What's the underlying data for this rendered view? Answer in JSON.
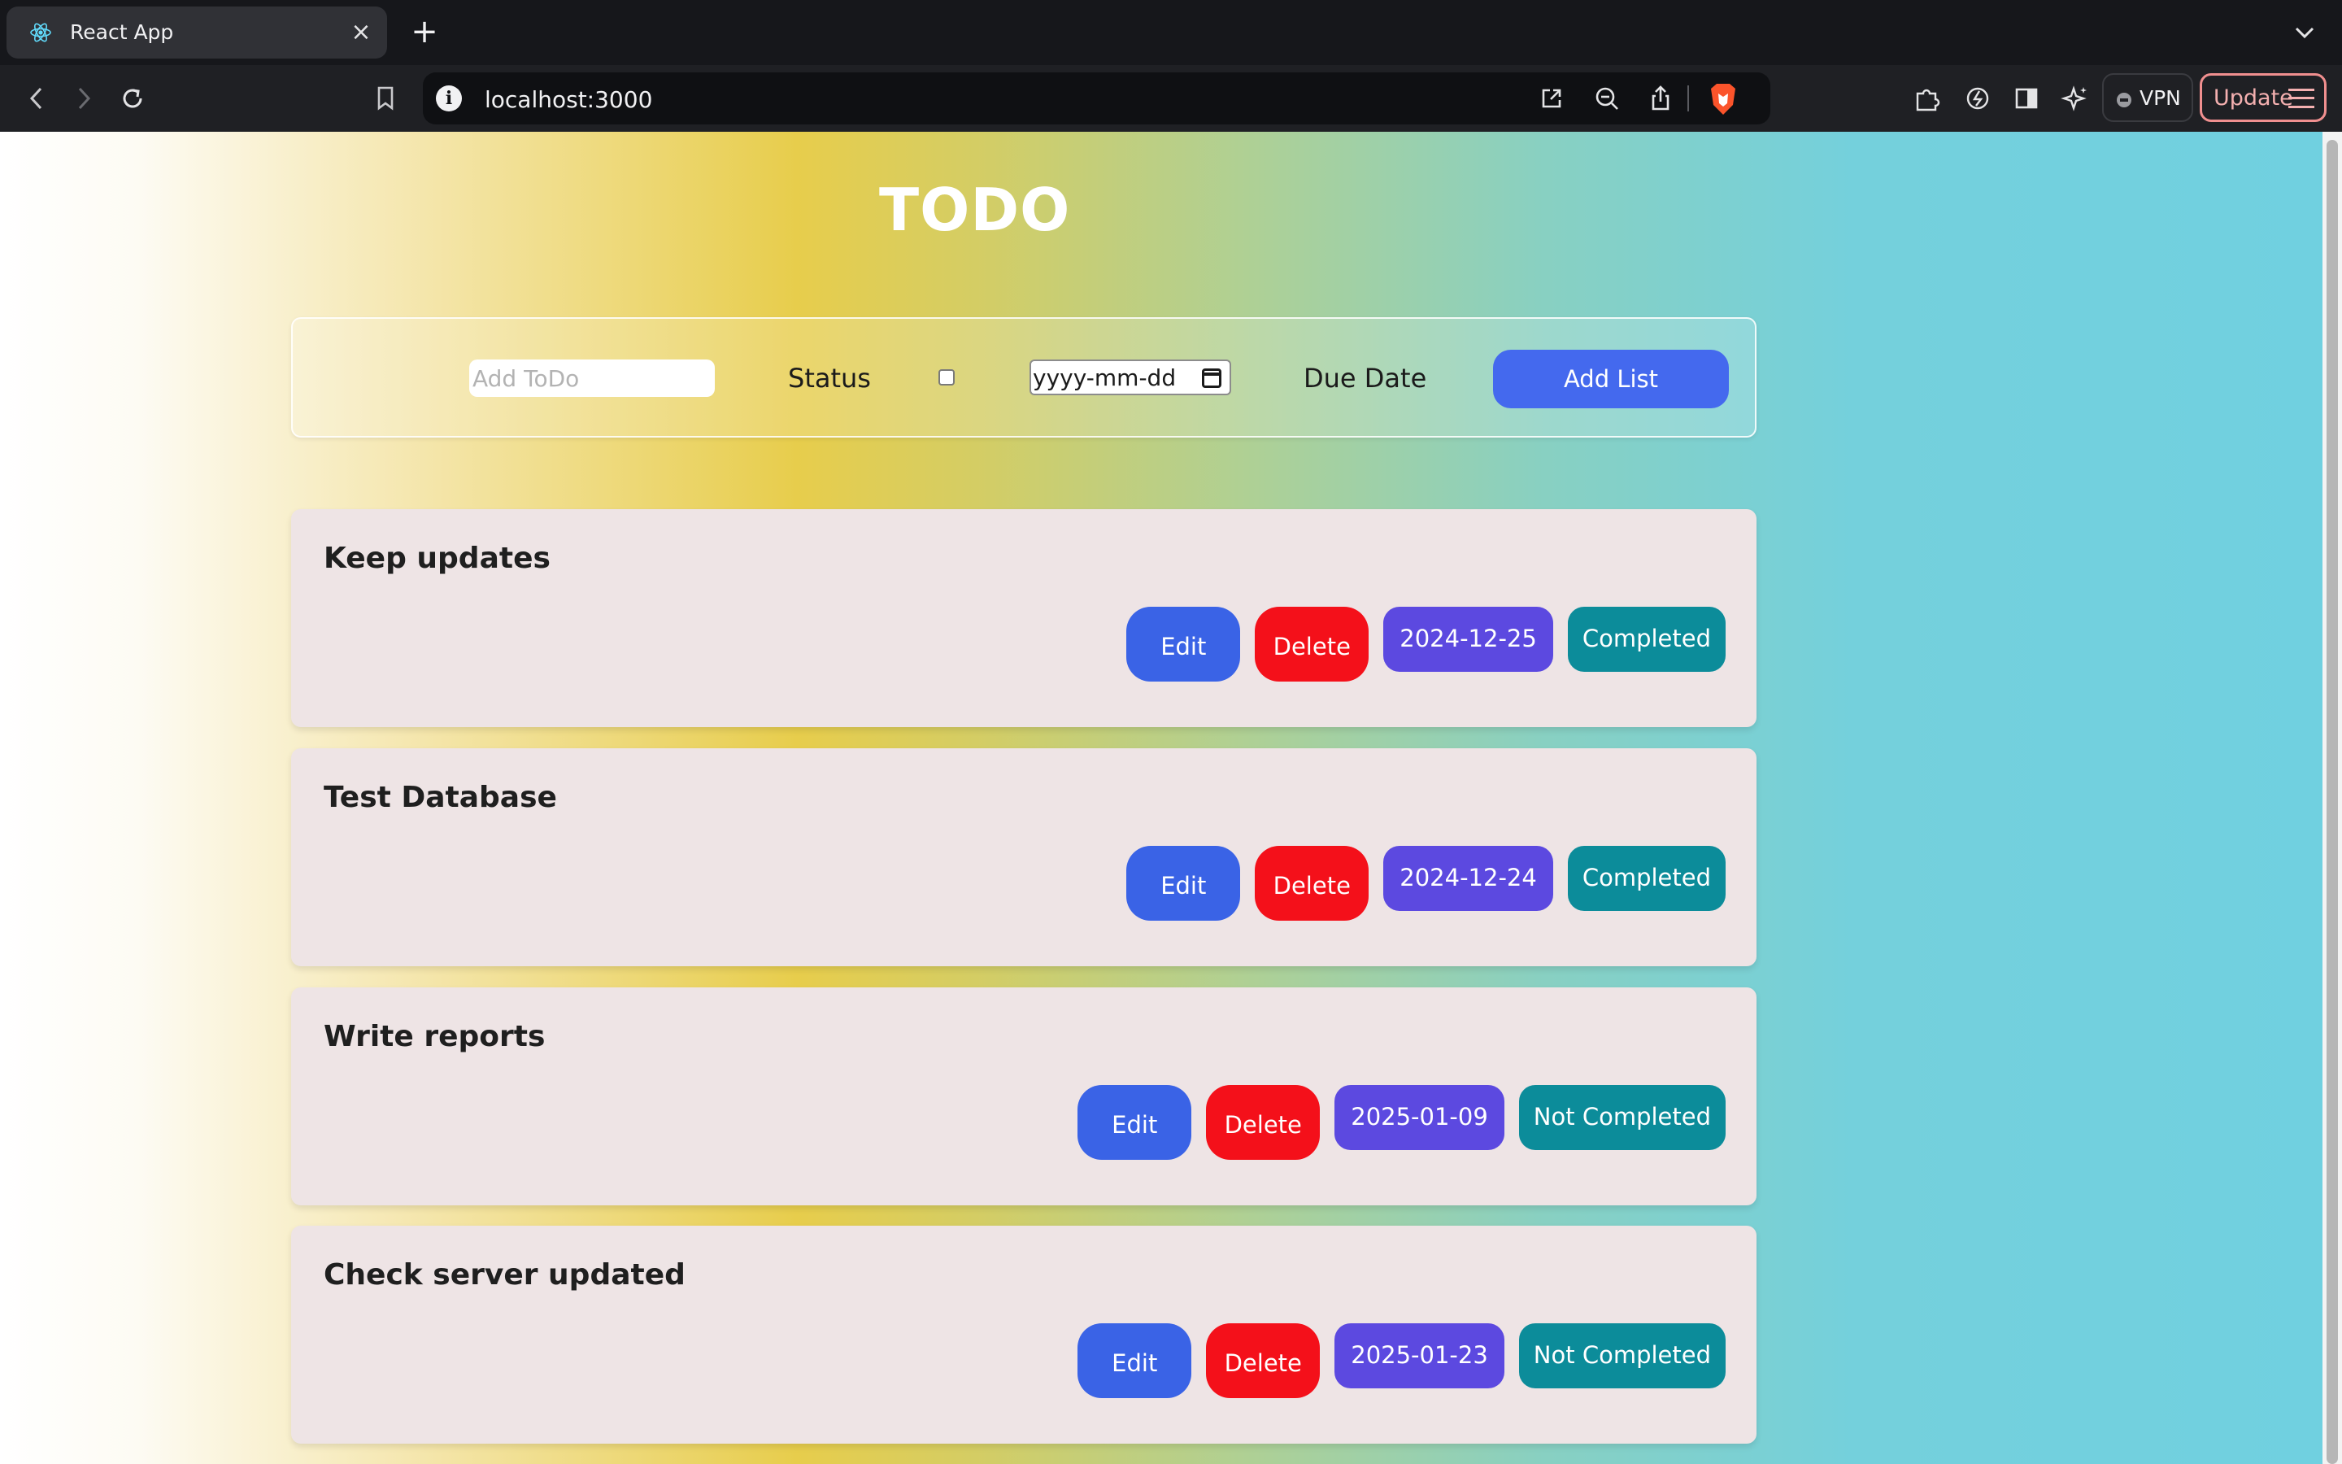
{
  "browser": {
    "tab_title": "React App",
    "url": "localhost:3000",
    "vpn_label": "VPN",
    "update_label": "Update"
  },
  "page": {
    "title": "TODO",
    "form": {
      "todo_placeholder": "Add ToDo",
      "status_label": "Status",
      "date_placeholder": "yyyy-mm-dd",
      "due_label": "Due Date",
      "add_button": "Add List"
    },
    "todos": [
      {
        "title": "Keep updates",
        "edit": "Edit",
        "delete": "Delete",
        "due": "2024-12-25",
        "status": "Completed"
      },
      {
        "title": "Test Database",
        "edit": "Edit",
        "delete": "Delete",
        "due": "2024-12-24",
        "status": "Completed"
      },
      {
        "title": "Write reports",
        "edit": "Edit",
        "delete": "Delete",
        "due": "2025-01-09",
        "status": "Not Completed"
      },
      {
        "title": "Check server updated",
        "edit": "Edit",
        "delete": "Delete",
        "due": "2025-01-23",
        "status": "Not Completed"
      }
    ]
  },
  "colors": {
    "edit_button": "#3a63e6",
    "delete_button": "#f4101a",
    "date_badge": "#5c49e0",
    "status_badge": "#0c8c9a",
    "add_button": "#4469ee",
    "card": "#eee4e5"
  }
}
